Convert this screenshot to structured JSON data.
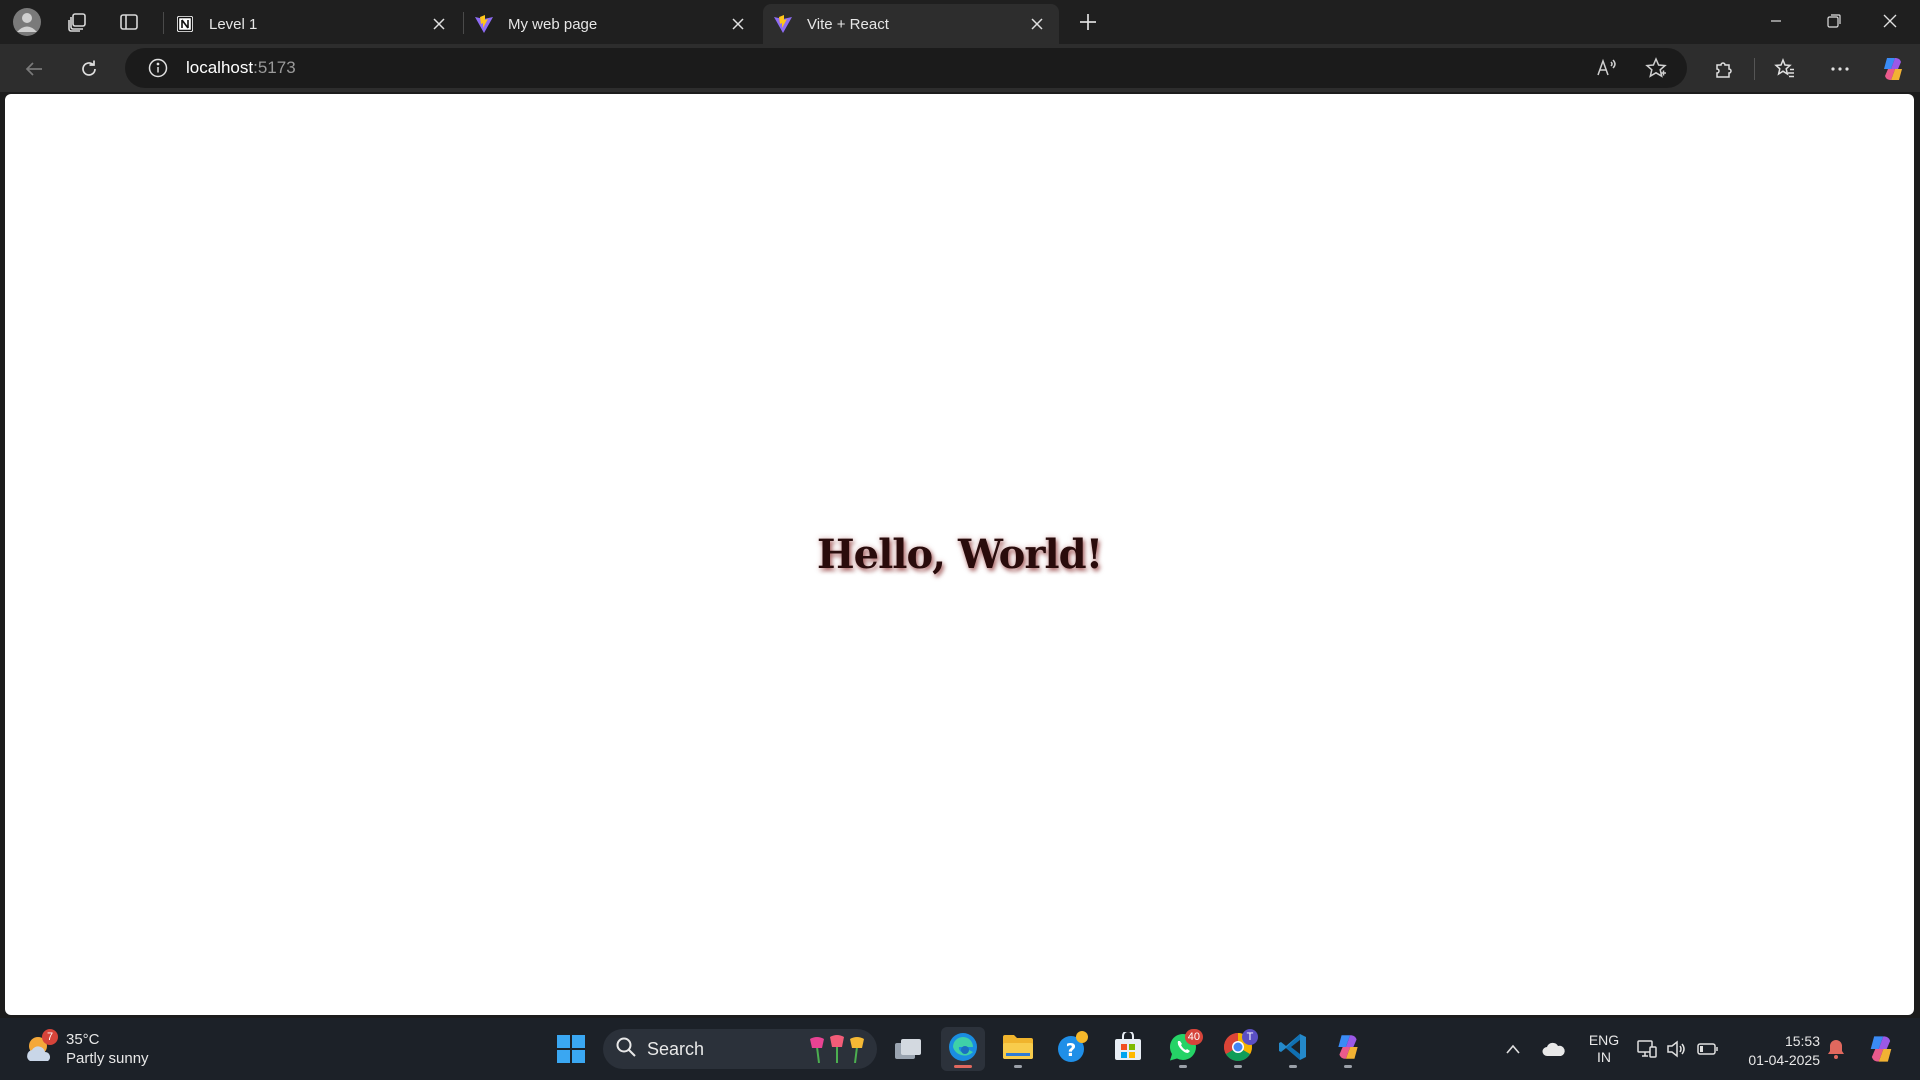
{
  "browser": {
    "tabs": [
      {
        "title": "Level 1",
        "favicon": "notion-icon",
        "active": false
      },
      {
        "title": "My web page",
        "favicon": "vite-icon",
        "active": false
      },
      {
        "title": "Vite + React",
        "favicon": "vite-icon",
        "active": true
      }
    ],
    "address": {
      "host": "localhost",
      "port": ":5173"
    }
  },
  "page": {
    "heading": "Hello, World!"
  },
  "taskbar": {
    "weather": {
      "badge": "7",
      "temp": "35°C",
      "condition": "Partly sunny"
    },
    "search_label": "Search",
    "whatsapp_badge": "40",
    "chrome_badge": "T",
    "language": {
      "line1": "ENG",
      "line2": "IN"
    },
    "clock": {
      "time": "15:53",
      "date": "01-04-2025"
    }
  },
  "colors": {
    "accent": "#e0685e",
    "heading": "#2a0c0c",
    "titlebar": "#1f1f1f",
    "toolbar": "#2d2d2d",
    "taskbar": "#1c2128"
  }
}
